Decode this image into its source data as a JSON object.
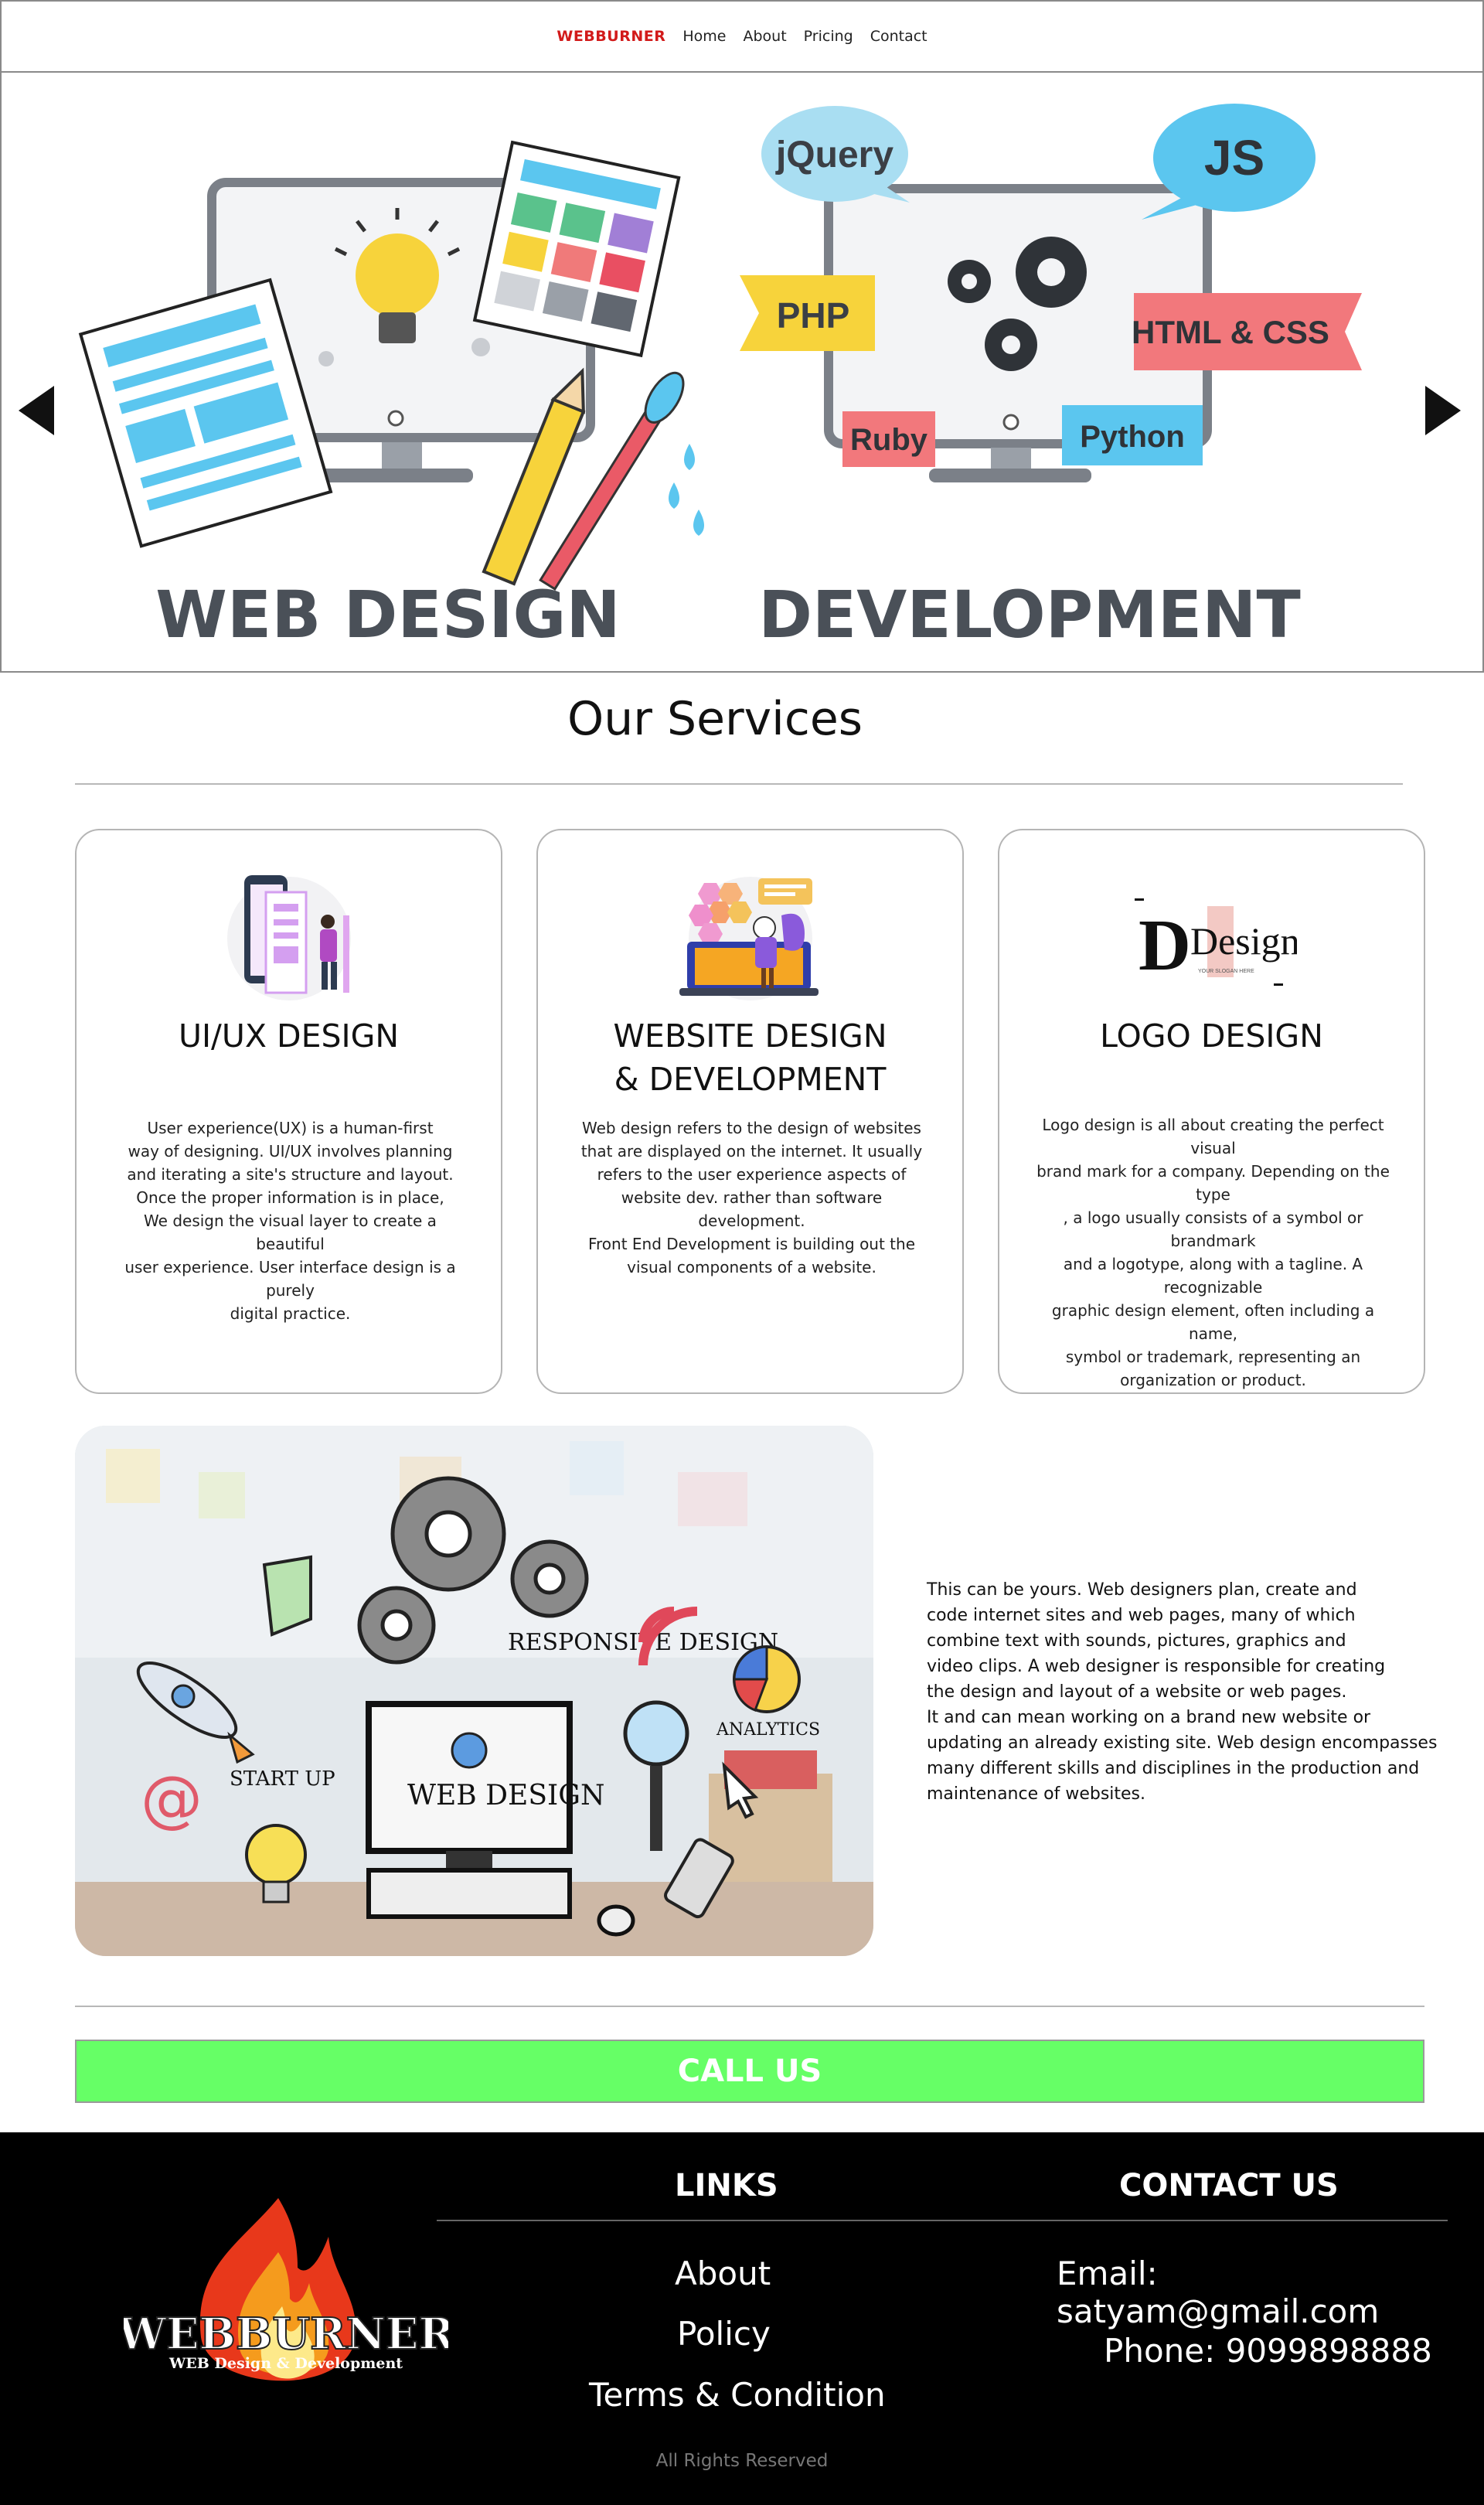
{
  "nav": {
    "brand": "WEBBURNER",
    "items": [
      {
        "label": "Home"
      },
      {
        "label": "About"
      },
      {
        "label": "Pricing"
      },
      {
        "label": "Contact"
      }
    ]
  },
  "hero": {
    "left_caption": "WEB DESIGN",
    "right_caption": "DEVELOPMENT",
    "tags": {
      "jquery": "jQuery",
      "js": "JS",
      "php": "PHP",
      "htmlcss": "HTML & CSS",
      "ruby": "Ruby",
      "python": "Python"
    }
  },
  "services": {
    "title": "Our Services",
    "cards": [
      {
        "title_lines": [
          "UI/UX DESIGN"
        ],
        "icon": "uiux-illustration-icon",
        "lines": [
          "User experience(UX) is a human-first",
          "way of designing. UI/UX involves planning",
          "and iterating a site's structure and layout.",
          "Once the proper information is in place,",
          "We design the visual layer to create a beautiful",
          "user experience. User interface design is a purely",
          "digital practice."
        ]
      },
      {
        "title_lines": [
          "WEBSITE DESIGN",
          "& DEVELOPMENT"
        ],
        "icon": "web-development-illustration-icon",
        "lines": [
          "Web design refers to the design of websites",
          "that are displayed on the internet. It usually",
          "refers to the user experience aspects of",
          "website dev. rather than software development.",
          "Front End Development is building out the",
          "visual components of a website."
        ]
      },
      {
        "title_lines": [
          "LOGO DESIGN"
        ],
        "icon": "logo-design-sample-icon",
        "logo_word": "Design",
        "logo_slogan": "YOUR SLOGAN HERE",
        "lines": [
          "Logo design is all about creating the perfect visual",
          "brand mark for a company. Depending on the type",
          ", a logo usually consists of a symbol or brandmark",
          "and a logotype, along with a tagline. A recognizable",
          "graphic design element, often including a name,",
          "symbol or trademark, representing an",
          "organization or product."
        ]
      }
    ]
  },
  "feature": {
    "image_labels": {
      "responsive": "RESPONSIVE DESIGN",
      "webdesign": "WEB DESIGN",
      "startup": "START UP",
      "analytics": "ANALYTICS"
    },
    "text": "This can be yours. Web designers plan, create and\ncode internet sites and web pages, many of which\ncombine text with sounds, pictures, graphics and\nvideo clips. A web designer is responsible for creating\n the design and layout of a website or web pages.\nIt and can mean working on a brand new website or\n updating an already existing site. Web design encompasses\n many different skills and disciplines in the production and\nmaintenance of websites."
  },
  "callus": {
    "label": "CALL US",
    "color": "#66ff66"
  },
  "footer": {
    "logo_text": "WEBBURNER",
    "logo_tagline": "WEB Design & Development",
    "links_title": "LINKS",
    "links": [
      {
        "label": "About"
      },
      {
        "label": "Policy"
      },
      {
        "label": "Terms & Condition"
      }
    ],
    "contact_title": "CONTACT US",
    "email": "Email: satyam@gmail.com",
    "phone": "Phone: 9099898888",
    "rights": "All Rights Reserved"
  },
  "colors": {
    "brand_red": "#d21a1a",
    "footer_bg": "#000000",
    "hero_caption": "#4a5058"
  }
}
